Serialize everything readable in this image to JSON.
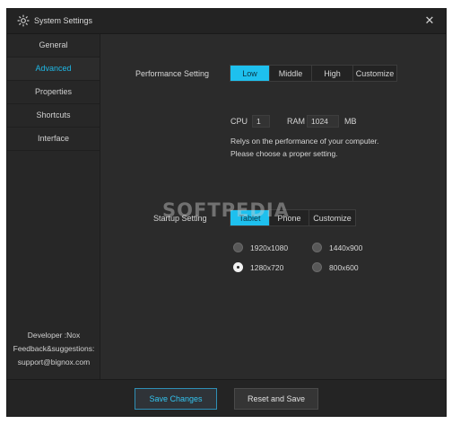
{
  "window": {
    "title": "System Settings"
  },
  "sidebar": {
    "items": [
      {
        "label": "General"
      },
      {
        "label": "Advanced"
      },
      {
        "label": "Properties"
      },
      {
        "label": "Shortcuts"
      },
      {
        "label": "Interface"
      }
    ],
    "active_index": 1,
    "developer": "Developer :Nox",
    "feedback": "Feedback&suggestions:",
    "email": "support@bignox.com"
  },
  "performance": {
    "label": "Performance Setting",
    "options": [
      "Low",
      "Middle",
      "High",
      "Customize"
    ],
    "selected": "Low",
    "cpu_label": "CPU",
    "cpu_value": "1",
    "ram_label": "RAM",
    "ram_value": "1024",
    "ram_unit": "MB",
    "desc_line1": "Relys on the performance of your computer.",
    "desc_line2": "Please choose a proper setting."
  },
  "startup": {
    "label": "Startup Setting",
    "options": [
      "Tablet",
      "Phone",
      "Customize"
    ],
    "selected": "Tablet",
    "resolutions": [
      {
        "label": "1920x1080",
        "checked": false
      },
      {
        "label": "1440x900",
        "checked": false
      },
      {
        "label": "1280x720",
        "checked": true
      },
      {
        "label": "800x600",
        "checked": false
      }
    ]
  },
  "watermark": "SOFTPEDIA",
  "footer": {
    "save_label": "Save Changes",
    "reset_label": "Reset and Save"
  },
  "colors": {
    "accent": "#1ec0ee",
    "background": "#2b2b2b"
  }
}
